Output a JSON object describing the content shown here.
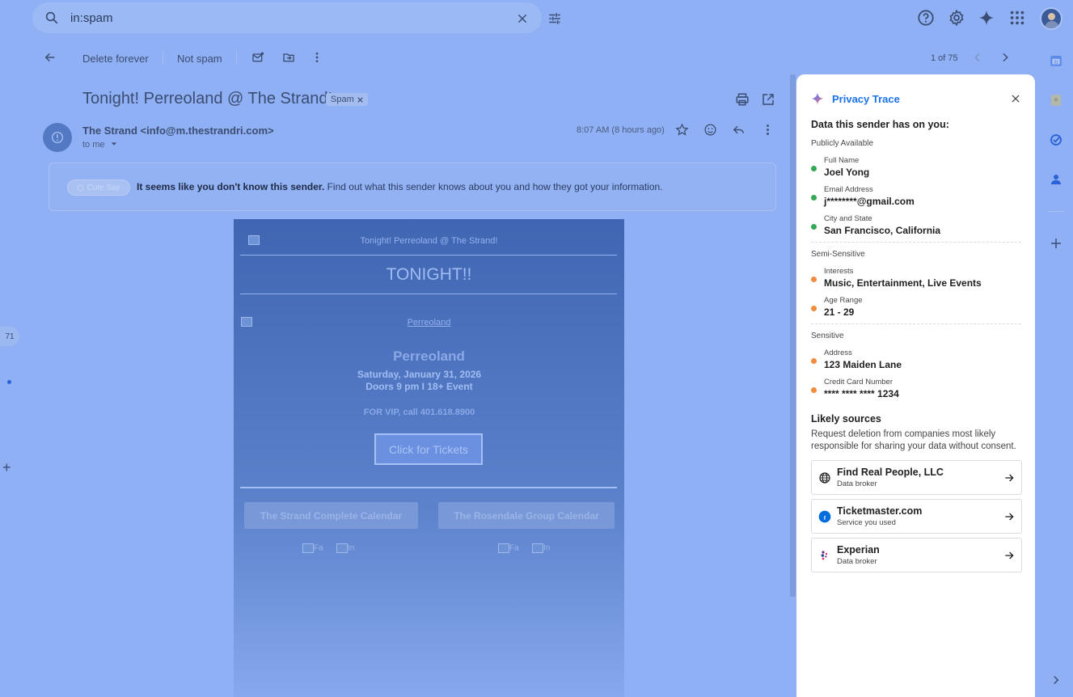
{
  "search": {
    "query": "in:spam"
  },
  "toolbar": {
    "delete_forever": "Delete forever",
    "not_spam": "Not spam",
    "pagination": "1 of 75"
  },
  "email": {
    "subject": "Tonight! Perreoland @ The Strand!",
    "label_chip": "Spam",
    "sender": "The Strand <info@m.thestrandri.com>",
    "recipient": "to me",
    "time": "8:07 AM (8 hours ago)"
  },
  "banner": {
    "pill_label": "Cute Say",
    "message_bold": "It seems like you don't know this sender.",
    "message_rest": "Find out what this sender knows about you and how they got your information."
  },
  "body": {
    "header_alt": "Tonight! Perreoland @ The Strand!",
    "headline": "TONIGHT!!",
    "image_link": "Perreoland",
    "event_name": "Perreoland",
    "event_date": "Saturday, January 31, 2026",
    "event_doors": "Doors 9 pm I 18+ Event",
    "vip": "FOR VIP, call 401.618.8900",
    "cta": "Click for Tickets",
    "calendar1": "The Strand Complete Calendar",
    "calendar2": "The Rosendale Group Calendar",
    "social_alt1": "Fa",
    "social_alt2": "In"
  },
  "left_rail": {
    "badge_count": "71"
  },
  "panel": {
    "title": "Privacy Trace",
    "heading": "Data this sender has on you:",
    "sections": [
      {
        "name": "Publicly Available",
        "items": [
          {
            "label": "Full Name",
            "value": "Joel Yong"
          },
          {
            "label": "Email Address",
            "value": "j********@gmail.com"
          },
          {
            "label": "City and State",
            "value": "San Francisco, California"
          }
        ]
      },
      {
        "name": "Semi-Sensitive",
        "items": [
          {
            "label": "Interests",
            "value": "Music, Entertainment, Live Events"
          },
          {
            "label": "Age Range",
            "value": "21 - 29"
          }
        ]
      },
      {
        "name": "Sensitive",
        "items": [
          {
            "label": "Address",
            "value": "123 Maiden Lane"
          },
          {
            "label": "Credit Card Number",
            "value": "**** **** **** 1234"
          }
        ]
      }
    ],
    "likely_sources_heading": "Likely sources",
    "likely_sources_desc": "Request deletion from companies most likely responsible for sharing your data without consent.",
    "sources": [
      {
        "name": "Find Real People, LLC",
        "type": "Data broker",
        "icon": "globe-icon"
      },
      {
        "name": "Ticketmaster.com",
        "type": "Service you used",
        "icon": "ticketmaster-icon"
      },
      {
        "name": "Experian",
        "type": "Data broker",
        "icon": "experian-icon"
      }
    ]
  },
  "colors": {
    "accent": "#1a73e8",
    "public_dot": "#34a853",
    "sensitive_dot": "#f28b3c",
    "overlay": "#8fb0f4"
  }
}
